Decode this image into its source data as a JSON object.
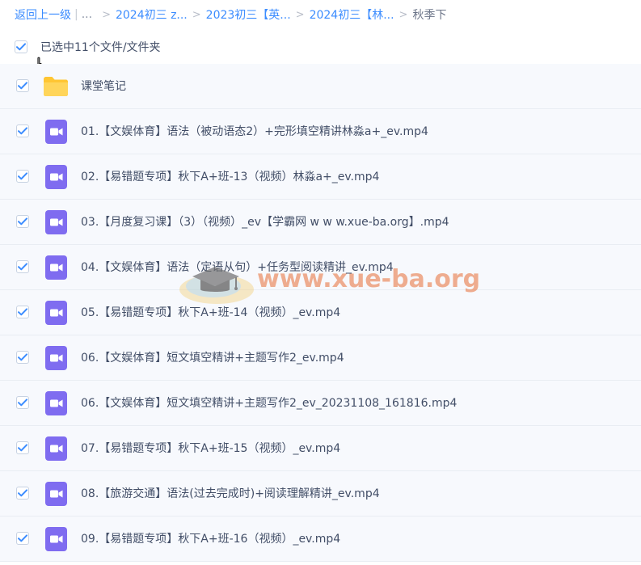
{
  "breadcrumb": {
    "back_label": "返回上一级",
    "pipe": "|",
    "ellipsis": "...",
    "crumbs": [
      "2024初三 z...",
      "2023初三【英...",
      "2024初三【林..."
    ],
    "current": "秋季下"
  },
  "selection": {
    "label": "已选中11个文件/文件夹",
    "checked": true
  },
  "files": [
    {
      "name": "课堂笔记",
      "type": "folder",
      "checked": true
    },
    {
      "name": "01.【文娱体育】语法（被动语态2）+完形填空精讲林淼a+_ev.mp4",
      "type": "video",
      "checked": true
    },
    {
      "name": "02.【易错题专项】秋下A+班-13（视频）林淼a+_ev.mp4",
      "type": "video",
      "checked": true
    },
    {
      "name": "03.【月度复习课】（3）（视频）_ev【学霸网 w w w.xue-ba.org】.mp4",
      "type": "video",
      "checked": true
    },
    {
      "name": "04.【文娱体育】语法（定语从句）+任务型阅读精讲_ev.mp4",
      "type": "video",
      "checked": true
    },
    {
      "name": "05.【易错题专项】秋下A+班-14（视频）_ev.mp4",
      "type": "video",
      "checked": true
    },
    {
      "name": "06.【文娱体育】短文填空精讲+主题写作2_ev.mp4",
      "type": "video",
      "checked": true
    },
    {
      "name": "06.【文娱体育】短文填空精讲+主题写作2_ev_20231108_161816.mp4",
      "type": "video",
      "checked": true
    },
    {
      "name": "07.【易错题专项】秋下A+班-15（视频）_ev.mp4",
      "type": "video",
      "checked": true
    },
    {
      "name": "08.【旅游交通】语法(过去完成时)+阅读理解精讲_ev.mp4",
      "type": "video",
      "checked": true
    },
    {
      "name": "09.【易错题专项】秋下A+班-16（视频）_ev.mp4",
      "type": "video",
      "checked": true
    }
  ],
  "watermark": {
    "text": "www.xue-ba.org"
  },
  "colors": {
    "link": "#3b8cff",
    "checkbox": "#3b8cff",
    "folder": "#ffd24a",
    "video": "#7b68ee",
    "row_bg": "#f7f9fd",
    "text": "#424e67",
    "watermark": "#e86e34"
  },
  "icons": {
    "checkbox": "check-icon",
    "folder": "folder-icon",
    "video": "video-file-icon",
    "cursor": "hand-pointer-icon"
  }
}
